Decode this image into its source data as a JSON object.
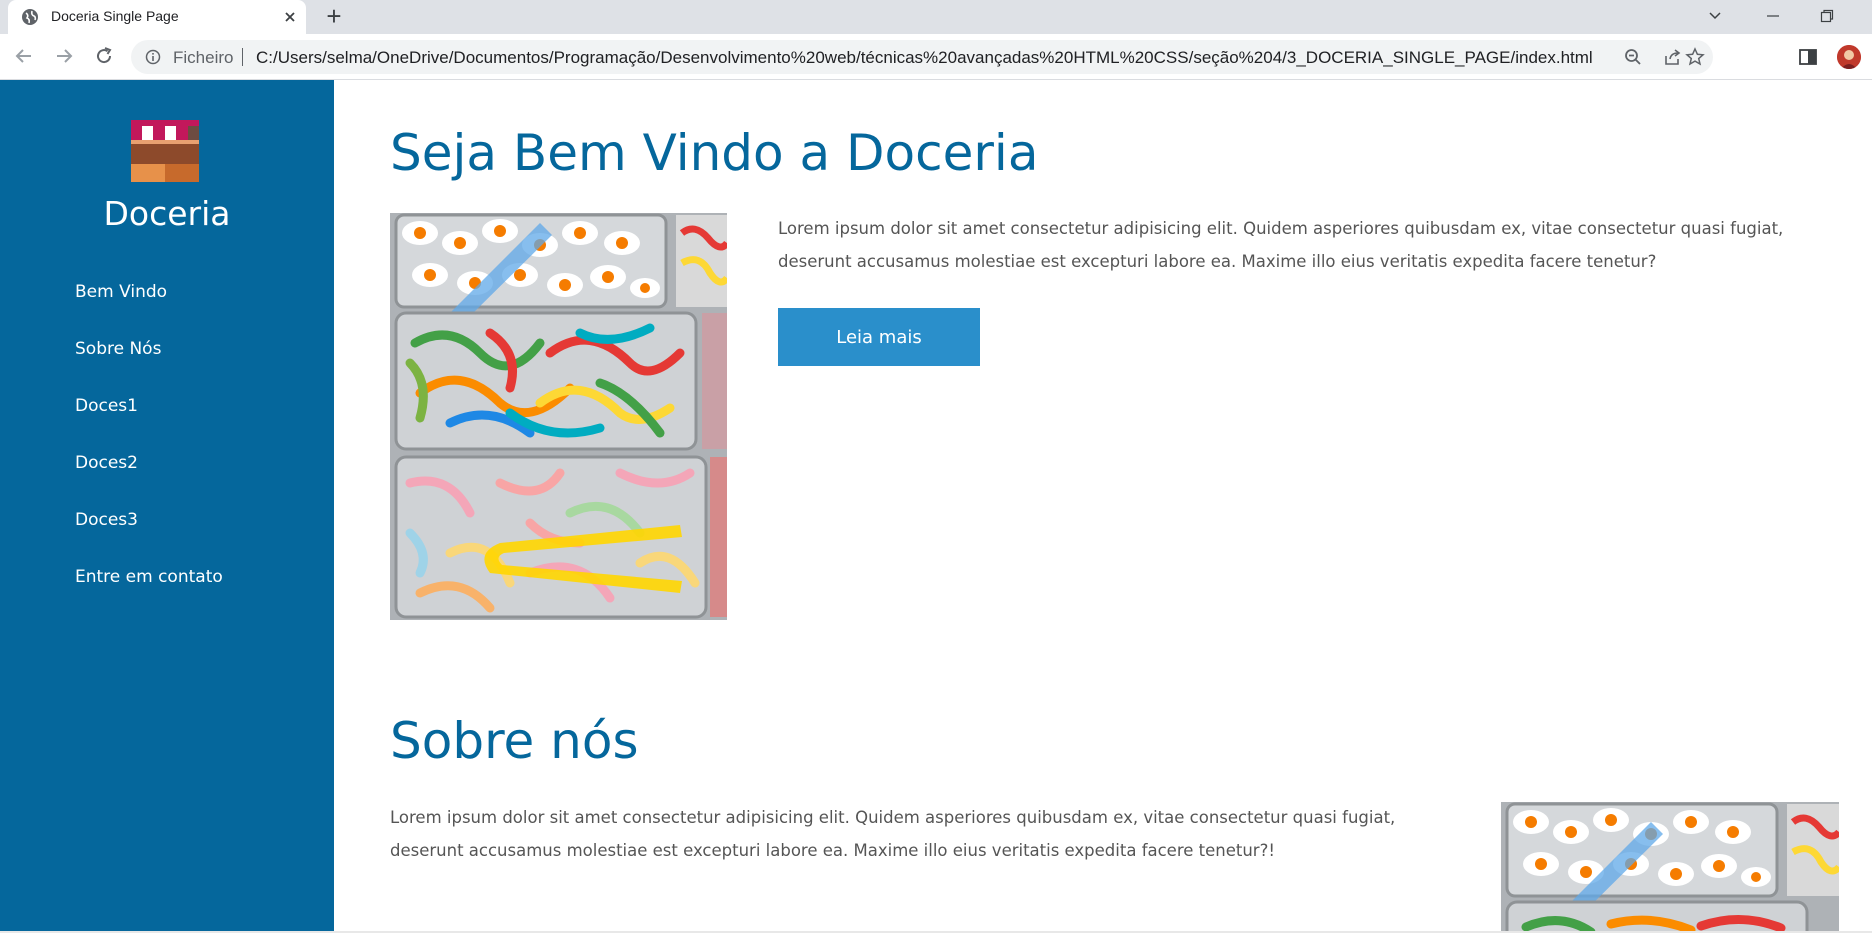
{
  "browser": {
    "tab": {
      "title": "Doceria Single Page"
    },
    "new_tab_label": "+",
    "omnibox": {
      "security_label": "Ficheiro",
      "url": "C:/Users/selma/OneDrive/Documentos/Programação/Desenvolvimento%20web/técnicas%20avançadas%20HTML%20CSS/seção%204/3_DOCERIA_SINGLE_PAGE/index.html"
    },
    "icons": [
      "globe-icon",
      "close-icon",
      "chevron-down-icon",
      "minimize-icon",
      "restore-icon",
      "back-icon",
      "forward-icon",
      "reload-icon",
      "info-icon",
      "zoom-icon",
      "share-icon",
      "star-icon",
      "side-panel-icon",
      "avatar"
    ]
  },
  "sidebar": {
    "brand": "Doceria",
    "nav": [
      {
        "label": "Bem Vindo"
      },
      {
        "label": "Sobre Nós"
      },
      {
        "label": "Doces1"
      },
      {
        "label": "Doces2"
      },
      {
        "label": "Doces3"
      },
      {
        "label": "Entre em contato"
      }
    ]
  },
  "welcome": {
    "title": "Seja Bem Vindo a Doceria",
    "text_lines": [
      "Lorem ipsum dolor sit amet consectetur adipisicing elit. Quidem asperiores quibusdam ex, vitae consectetur quasi fugiat,",
      "deserunt accusamus molestiae est excepturi labore ea. Maxime illo eius veritatis expedita facere tenetur?"
    ],
    "button_label": "Leia mais"
  },
  "about": {
    "title": "Sobre nós",
    "text_lines": [
      "Lorem ipsum dolor sit amet consectetur adipisicing elit. Quidem asperiores quibusdam ex, vitae consectetur quasi fugiat,",
      "deserunt accusamus molestiae est excepturi labore ea. Maxime illo eius veritatis expedita facere tenetur?!"
    ]
  },
  "colors": {
    "sidebar_bg": "#05679c",
    "heading": "#05679c",
    "button_bg": "#2a8fcb",
    "body_text": "#555555"
  }
}
